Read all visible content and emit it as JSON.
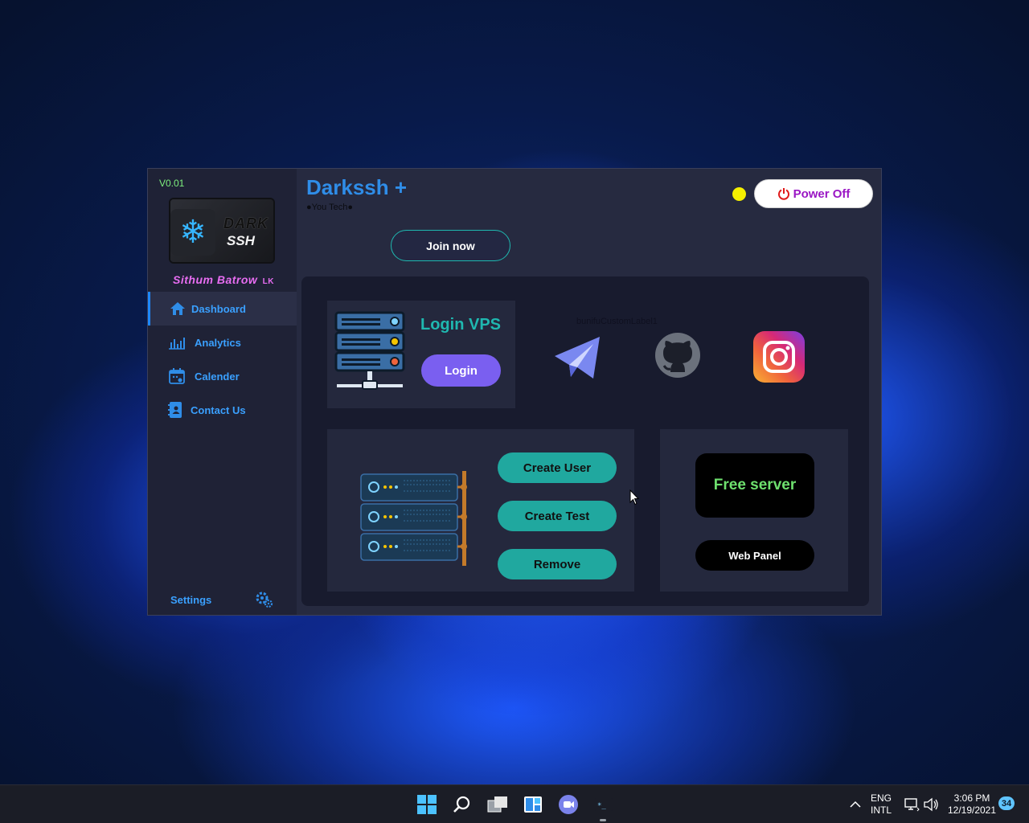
{
  "app": {
    "version": "V0.01",
    "logo": {
      "line1": "DARK",
      "line2": "SSH"
    },
    "author": "Sithum Batrow",
    "author_suffix": "LK",
    "title": "Darkssh +",
    "subtitle": "You Tech",
    "power_button": "Power Off",
    "join_button": "Join now"
  },
  "sidebar": {
    "items": [
      {
        "label": "Dashboard",
        "icon": "home-icon",
        "active": true
      },
      {
        "label": "Analytics",
        "icon": "bar-chart-icon",
        "active": false
      },
      {
        "label": "Calender",
        "icon": "calendar-icon",
        "active": false
      },
      {
        "label": "Contact Us",
        "icon": "contact-book-icon",
        "active": false
      }
    ],
    "settings_label": "Settings"
  },
  "dashboard": {
    "vps_title": "Login VPS",
    "login_button": "Login",
    "custom_label": "bunifuCustomLabel1",
    "social": [
      "telegram-icon",
      "github-icon",
      "instagram-icon"
    ],
    "actions": [
      "Create User",
      "Create Test",
      "Remove"
    ],
    "free_server": "Free server",
    "web_panel": "Web Panel"
  },
  "taskbar": {
    "lang_line1": "ENG",
    "lang_line2": "INTL",
    "time": "3:06 PM",
    "date": "12/19/2021",
    "notifications": "34"
  },
  "colors": {
    "accent_blue": "#2f8de8",
    "teal": "#20a89f",
    "purple": "#7a5ff0",
    "status_yellow": "#f5f000",
    "author_pink": "#e86df2"
  }
}
